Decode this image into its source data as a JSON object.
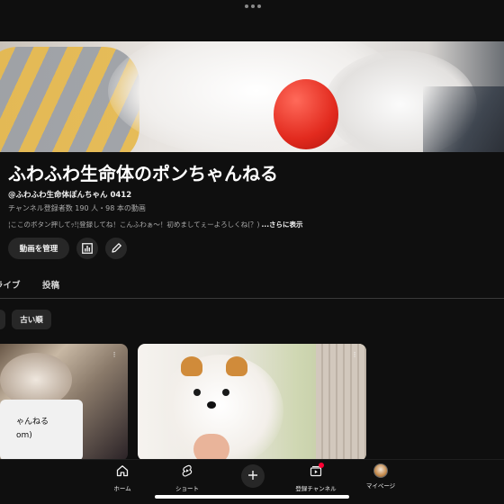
{
  "channel": {
    "title": "ふわふわ生命体のポンちゃんねる",
    "handle": "@ふわふわ生命体ぽんちゃん 0412",
    "stats": "チャンネル登録者数 190 人・98 本の動画",
    "description": "¦ここのボタン押してｯ!¦登録してね！こんふわぁ〜！初めましてぇーよろしくね(？)",
    "more": "...さらに表示"
  },
  "actions": {
    "manage_label": "動画を管理",
    "analytics_icon": "analytics-icon",
    "edit_icon": "pencil-icon"
  },
  "tabs": [
    {
      "label": "ライブ"
    },
    {
      "label": "投稿"
    }
  ],
  "sort_chips": [
    {
      "label": ""
    },
    {
      "label": "古い順"
    }
  ],
  "cards": [
    {
      "tooltip_line1": "ゃんねる",
      "tooltip_line2": "om)"
    },
    {}
  ],
  "bottom_nav": [
    {
      "label": "ホーム",
      "icon": "home-icon"
    },
    {
      "label": "ショート",
      "icon": "shorts-icon"
    },
    {
      "label": "",
      "icon": "add-icon"
    },
    {
      "label": "登録チャンネル",
      "icon": "subscriptions-icon"
    },
    {
      "label": "マイページ",
      "icon": "avatar"
    }
  ],
  "colors": {
    "background": "#0f0f0f",
    "surface": "#272727",
    "text": "#f1f1f1",
    "muted": "#aaaaaa",
    "notification": "#ff0033"
  }
}
